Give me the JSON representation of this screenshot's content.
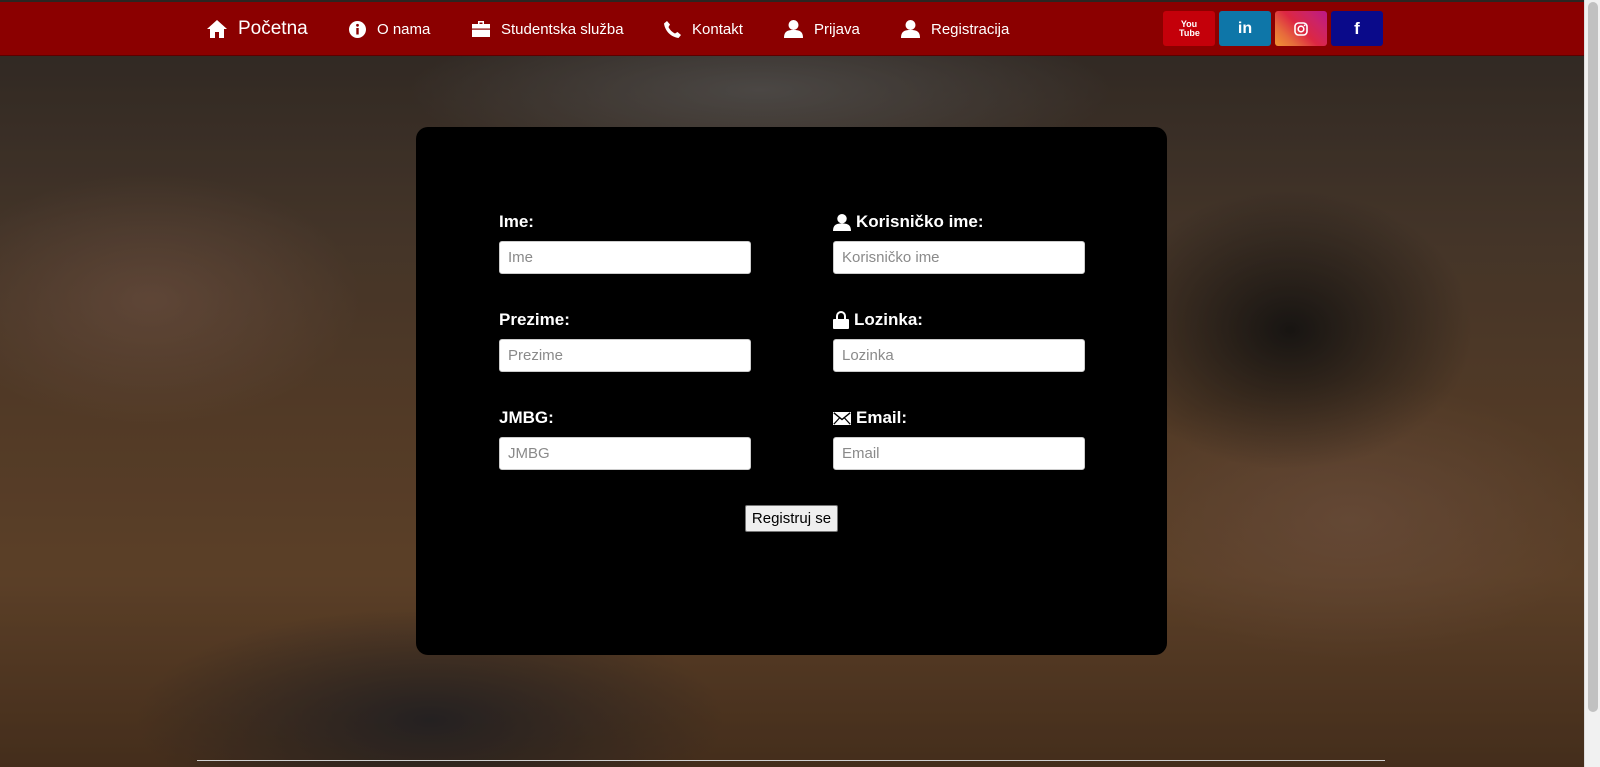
{
  "nav": {
    "home": "Početna",
    "about": "O nama",
    "student_service": "Studentska služba",
    "contact": "Kontakt",
    "login": "Prijava",
    "register": "Registracija"
  },
  "social": {
    "youtube": "You Tube",
    "linkedin": "in",
    "instagram": "instagram",
    "facebook": "f"
  },
  "form": {
    "first_name": {
      "label": "Ime:",
      "placeholder": "Ime"
    },
    "last_name": {
      "label": "Prezime:",
      "placeholder": "Prezime"
    },
    "jmbg": {
      "label": "JMBG:",
      "placeholder": "JMBG"
    },
    "username": {
      "label": "Korisničko ime:",
      "placeholder": "Korisničko ime"
    },
    "password": {
      "label": "Lozinka:",
      "placeholder": "Lozinka"
    },
    "email": {
      "label": "Email:",
      "placeholder": "Email"
    },
    "submit_label": "Registruj se"
  },
  "colors": {
    "navbar": "#8b0000",
    "panel": "#000000",
    "youtube": "#c4000a",
    "linkedin": "#0e76a8",
    "facebook": "#0a0a8a"
  }
}
